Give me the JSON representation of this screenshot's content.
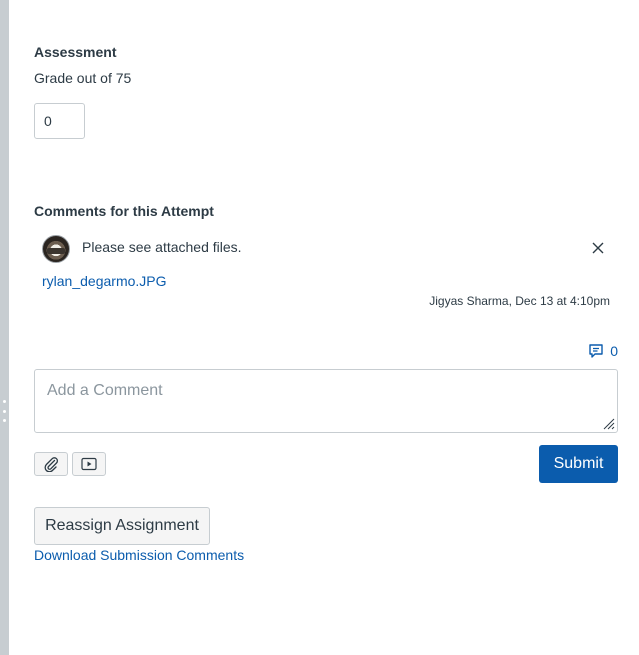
{
  "assessment": {
    "heading": "Assessment",
    "grade_label": "Grade out of 75",
    "grade_value": "0"
  },
  "comments": {
    "heading": "Comments for this Attempt",
    "items": [
      {
        "text": "Please see attached files.",
        "attachment": "rylan_degarmo.JPG",
        "meta": "Jigyas Sharma, Dec 13 at 4:10pm"
      }
    ],
    "media_count": "0",
    "input_placeholder": "Add a Comment",
    "submit_label": "Submit"
  },
  "actions": {
    "reassign_label": "Reassign Assignment",
    "download_label": "Download Submission Comments"
  },
  "colors": {
    "accent": "#0b5cad",
    "text": "#2d3b45",
    "border": "#c7cdd1",
    "rail": "#c7cdd1"
  },
  "icons": {
    "delete": "close-icon",
    "media_comments": "speech-bubble-icon",
    "attach": "paperclip-icon",
    "media": "video-play-icon"
  }
}
